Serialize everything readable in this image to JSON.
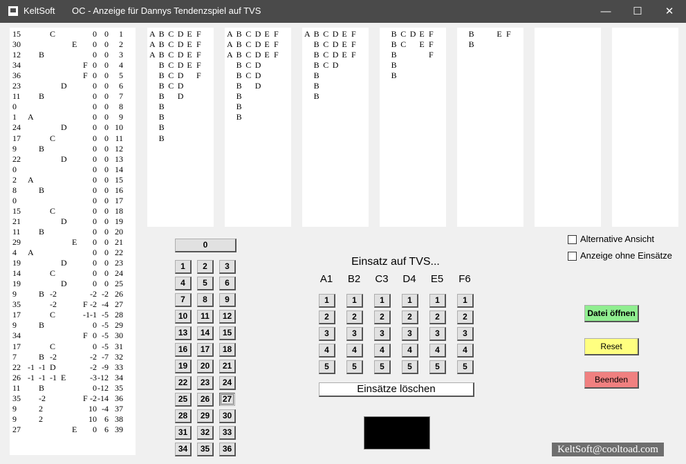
{
  "window": {
    "app_name": "KeltSoft",
    "title": "OC - Anzeige für Dannys Tendenzspiel auf TVS",
    "minimize_glyph": "—",
    "maximize_glyph": "☐",
    "close_glyph": "✕"
  },
  "history": {
    "rows": [
      {
        "n": "15",
        "a": "",
        "b": "",
        "c": "C",
        "d": "",
        "e": "",
        "f": "",
        "s1": "0",
        "s2": "0",
        "i": "1"
      },
      {
        "n": "30",
        "a": "",
        "b": "",
        "c": "",
        "d": "",
        "e": "E",
        "f": "",
        "s1": "0",
        "s2": "0",
        "i": "2"
      },
      {
        "n": "12",
        "a": "",
        "b": "B",
        "c": "",
        "d": "",
        "e": "",
        "f": "",
        "s1": "0",
        "s2": "0",
        "i": "3"
      },
      {
        "n": "34",
        "a": "",
        "b": "",
        "c": "",
        "d": "",
        "e": "",
        "f": "F",
        "s1": "0",
        "s2": "0",
        "i": "4"
      },
      {
        "n": "36",
        "a": "",
        "b": "",
        "c": "",
        "d": "",
        "e": "",
        "f": "F",
        "s1": "0",
        "s2": "0",
        "i": "5"
      },
      {
        "n": "23",
        "a": "",
        "b": "",
        "c": "",
        "d": "D",
        "e": "",
        "f": "",
        "s1": "0",
        "s2": "0",
        "i": "6"
      },
      {
        "n": "11",
        "a": "",
        "b": "B",
        "c": "",
        "d": "",
        "e": "",
        "f": "",
        "s1": "0",
        "s2": "0",
        "i": "7"
      },
      {
        "n": "0",
        "a": "",
        "b": "",
        "c": "",
        "d": "",
        "e": "",
        "f": "",
        "s1": "0",
        "s2": "0",
        "i": "8"
      },
      {
        "n": "1",
        "a": "A",
        "b": "",
        "c": "",
        "d": "",
        "e": "",
        "f": "",
        "s1": "0",
        "s2": "0",
        "i": "9"
      },
      {
        "n": "24",
        "a": "",
        "b": "",
        "c": "",
        "d": "D",
        "e": "",
        "f": "",
        "s1": "0",
        "s2": "0",
        "i": "10"
      },
      {
        "n": "17",
        "a": "",
        "b": "",
        "c": "C",
        "d": "",
        "e": "",
        "f": "",
        "s1": "0",
        "s2": "0",
        "i": "11"
      },
      {
        "n": "9",
        "a": "",
        "b": "B",
        "c": "",
        "d": "",
        "e": "",
        "f": "",
        "s1": "0",
        "s2": "0",
        "i": "12"
      },
      {
        "n": "22",
        "a": "",
        "b": "",
        "c": "",
        "d": "D",
        "e": "",
        "f": "",
        "s1": "0",
        "s2": "0",
        "i": "13"
      },
      {
        "n": "0",
        "a": "",
        "b": "",
        "c": "",
        "d": "",
        "e": "",
        "f": "",
        "s1": "0",
        "s2": "0",
        "i": "14"
      },
      {
        "n": "2",
        "a": "A",
        "b": "",
        "c": "",
        "d": "",
        "e": "",
        "f": "",
        "s1": "0",
        "s2": "0",
        "i": "15"
      },
      {
        "n": "8",
        "a": "",
        "b": "B",
        "c": "",
        "d": "",
        "e": "",
        "f": "",
        "s1": "0",
        "s2": "0",
        "i": "16"
      },
      {
        "n": "0",
        "a": "",
        "b": "",
        "c": "",
        "d": "",
        "e": "",
        "f": "",
        "s1": "0",
        "s2": "0",
        "i": "17"
      },
      {
        "n": "15",
        "a": "",
        "b": "",
        "c": "C",
        "d": "",
        "e": "",
        "f": "",
        "s1": "0",
        "s2": "0",
        "i": "18"
      },
      {
        "n": "21",
        "a": "",
        "b": "",
        "c": "",
        "d": "D",
        "e": "",
        "f": "",
        "s1": "0",
        "s2": "0",
        "i": "19"
      },
      {
        "n": "11",
        "a": "",
        "b": "B",
        "c": "",
        "d": "",
        "e": "",
        "f": "",
        "s1": "0",
        "s2": "0",
        "i": "20"
      },
      {
        "n": "29",
        "a": "",
        "b": "",
        "c": "",
        "d": "",
        "e": "E",
        "f": "",
        "s1": "0",
        "s2": "0",
        "i": "21"
      },
      {
        "n": "4",
        "a": "A",
        "b": "",
        "c": "",
        "d": "",
        "e": "",
        "f": "",
        "s1": "0",
        "s2": "0",
        "i": "22"
      },
      {
        "n": "19",
        "a": "",
        "b": "",
        "c": "",
        "d": "D",
        "e": "",
        "f": "",
        "s1": "0",
        "s2": "0",
        "i": "23"
      },
      {
        "n": "14",
        "a": "",
        "b": "",
        "c": "C",
        "d": "",
        "e": "",
        "f": "",
        "s1": "0",
        "s2": "0",
        "i": "24"
      },
      {
        "n": "19",
        "a": "",
        "b": "",
        "c": "",
        "d": "D",
        "e": "",
        "f": "",
        "s1": "0",
        "s2": "0",
        "i": "25"
      },
      {
        "n": "9",
        "a": "",
        "b": "B",
        "c": "-2",
        "d": "",
        "e": "",
        "f": "",
        "s1": "-2",
        "s2": "-2",
        "i": "26"
      },
      {
        "n": "35",
        "a": "",
        "b": "",
        "c": "-2",
        "d": "",
        "e": "",
        "f": "F",
        "s1": "-2",
        "s2": "-4",
        "i": "27"
      },
      {
        "n": "17",
        "a": "",
        "b": "",
        "c": "C",
        "d": "",
        "e": "",
        "f": "-1",
        "s1": "-1",
        "s2": "-5",
        "i": "28"
      },
      {
        "n": "9",
        "a": "",
        "b": "B",
        "c": "",
        "d": "",
        "e": "",
        "f": "",
        "s1": "0",
        "s2": "-5",
        "i": "29"
      },
      {
        "n": "34",
        "a": "",
        "b": "",
        "c": "",
        "d": "",
        "e": "",
        "f": "F",
        "s1": "0",
        "s2": "-5",
        "i": "30"
      },
      {
        "n": "17",
        "a": "",
        "b": "",
        "c": "C",
        "d": "",
        "e": "",
        "f": "",
        "s1": "0",
        "s2": "-5",
        "i": "31"
      },
      {
        "n": "7",
        "a": "",
        "b": "B",
        "c": "-2",
        "d": "",
        "e": "",
        "f": "",
        "s1": "-2",
        "s2": "-7",
        "i": "32"
      },
      {
        "n": "22",
        "a": "-1",
        "b": "-1",
        "c": "D",
        "d": "",
        "e": "",
        "f": "",
        "s1": "-2",
        "s2": "-9",
        "i": "33"
      },
      {
        "n": "26",
        "a": "-1",
        "b": "-1",
        "c": "-1",
        "d": "E",
        "e": "",
        "f": "",
        "s1": "-3",
        "s2": "-12",
        "i": "34"
      },
      {
        "n": "11",
        "a": "",
        "b": "B",
        "c": "",
        "d": "",
        "e": "",
        "f": "",
        "s1": "0",
        "s2": "-12",
        "i": "35"
      },
      {
        "n": "35",
        "a": "",
        "b": "-2",
        "c": "",
        "d": "",
        "e": "",
        "f": "F",
        "s1": "-2",
        "s2": "-14",
        "i": "36"
      },
      {
        "n": "9",
        "a": "",
        "b": "2",
        "c": "",
        "d": "",
        "e": "",
        "f": "",
        "s1": "10",
        "s2": "-4",
        "i": "37"
      },
      {
        "n": "9",
        "a": "",
        "b": "2",
        "c": "",
        "d": "",
        "e": "",
        "f": "",
        "s1": "10",
        "s2": "6",
        "i": "38"
      },
      {
        "n": "27",
        "a": "",
        "b": "",
        "c": "",
        "d": "",
        "e": "E",
        "f": "",
        "s1": "0",
        "s2": "6",
        "i": "39"
      }
    ]
  },
  "columns": [
    {
      "rows": [
        [
          "A",
          "B",
          "C",
          "D",
          "E",
          "F"
        ],
        [
          "A",
          "B",
          "C",
          "D",
          "E",
          "F"
        ],
        [
          "A",
          "B",
          "C",
          "D",
          "E",
          "F"
        ],
        [
          "",
          "B",
          "C",
          "D",
          "E",
          "F"
        ],
        [
          "",
          "B",
          "C",
          "D",
          "",
          "F"
        ],
        [
          "",
          "B",
          "C",
          "D",
          "",
          ""
        ],
        [
          "",
          "B",
          "",
          "D",
          "",
          ""
        ],
        [
          "",
          "B",
          "",
          "",
          "",
          ""
        ],
        [
          "",
          "B",
          "",
          "",
          "",
          ""
        ],
        [
          "",
          "B",
          "",
          "",
          "",
          ""
        ],
        [
          "",
          "B",
          "",
          "",
          "",
          ""
        ]
      ]
    },
    {
      "rows": [
        [
          "A",
          "B",
          "C",
          "D",
          "E",
          "F"
        ],
        [
          "A",
          "B",
          "C",
          "D",
          "E",
          "F"
        ],
        [
          "A",
          "B",
          "C",
          "D",
          "E",
          "F"
        ],
        [
          "",
          "B",
          "C",
          "D",
          "",
          ""
        ],
        [
          "",
          "B",
          "C",
          "D",
          "",
          ""
        ],
        [
          "",
          "B",
          "",
          "D",
          "",
          ""
        ],
        [
          "",
          "B",
          "",
          "",
          "",
          ""
        ],
        [
          "",
          "B",
          "",
          "",
          "",
          ""
        ],
        [
          "",
          "B",
          "",
          "",
          "",
          ""
        ]
      ]
    },
    {
      "rows": [
        [
          "A",
          "B",
          "C",
          "D",
          "E",
          "F"
        ],
        [
          "",
          "B",
          "C",
          "D",
          "E",
          "F"
        ],
        [
          "",
          "B",
          "C",
          "D",
          "E",
          "F"
        ],
        [
          "",
          "B",
          "C",
          "D",
          "",
          ""
        ],
        [
          "",
          "B",
          "",
          "",
          "",
          ""
        ],
        [
          "",
          "B",
          "",
          "",
          "",
          ""
        ],
        [
          "",
          "B",
          "",
          "",
          "",
          ""
        ]
      ]
    },
    {
      "rows": [
        [
          "",
          "B",
          "C",
          "D",
          "E",
          "F"
        ],
        [
          "",
          "B",
          "C",
          "",
          "E",
          "F"
        ],
        [
          "",
          "B",
          "",
          "",
          "",
          "F"
        ],
        [
          "",
          "B",
          "",
          "",
          "",
          ""
        ],
        [
          "",
          "B",
          "",
          "",
          "",
          ""
        ]
      ]
    },
    {
      "rows": [
        [
          "",
          "B",
          "",
          "",
          "E",
          "F"
        ],
        [
          "",
          "B",
          "",
          "",
          "",
          ""
        ]
      ]
    },
    {
      "rows": []
    },
    {
      "rows": []
    }
  ],
  "numbers": {
    "zero_label": "0",
    "grid": [
      "1",
      "2",
      "3",
      "4",
      "5",
      "6",
      "7",
      "8",
      "9",
      "10",
      "11",
      "12",
      "13",
      "14",
      "15",
      "16",
      "17",
      "18",
      "19",
      "20",
      "21",
      "22",
      "23",
      "24",
      "25",
      "26",
      "27",
      "28",
      "29",
      "30",
      "31",
      "32",
      "33",
      "34",
      "35",
      "36"
    ],
    "pressed": "27"
  },
  "stakes": {
    "heading": "Einsatz auf TVS...",
    "groups": [
      "A1",
      "B2",
      "C3",
      "D4",
      "E5",
      "F6"
    ],
    "values": [
      "1",
      "2",
      "3",
      "4",
      "5"
    ],
    "clear_label": "Einsätze löschen"
  },
  "options": {
    "alternative_view": "Alternative Ansicht",
    "no_stakes_view": "Anzeige ohne Einsätze"
  },
  "actions": {
    "open_file": "Datei öffnen",
    "reset": "Reset",
    "quit": "Beenden",
    "open_color": "#90ee90",
    "reset_color": "#ffff80",
    "quit_color": "#f08080"
  },
  "footer": {
    "email": "KeltSoft@cooltoad.com"
  }
}
